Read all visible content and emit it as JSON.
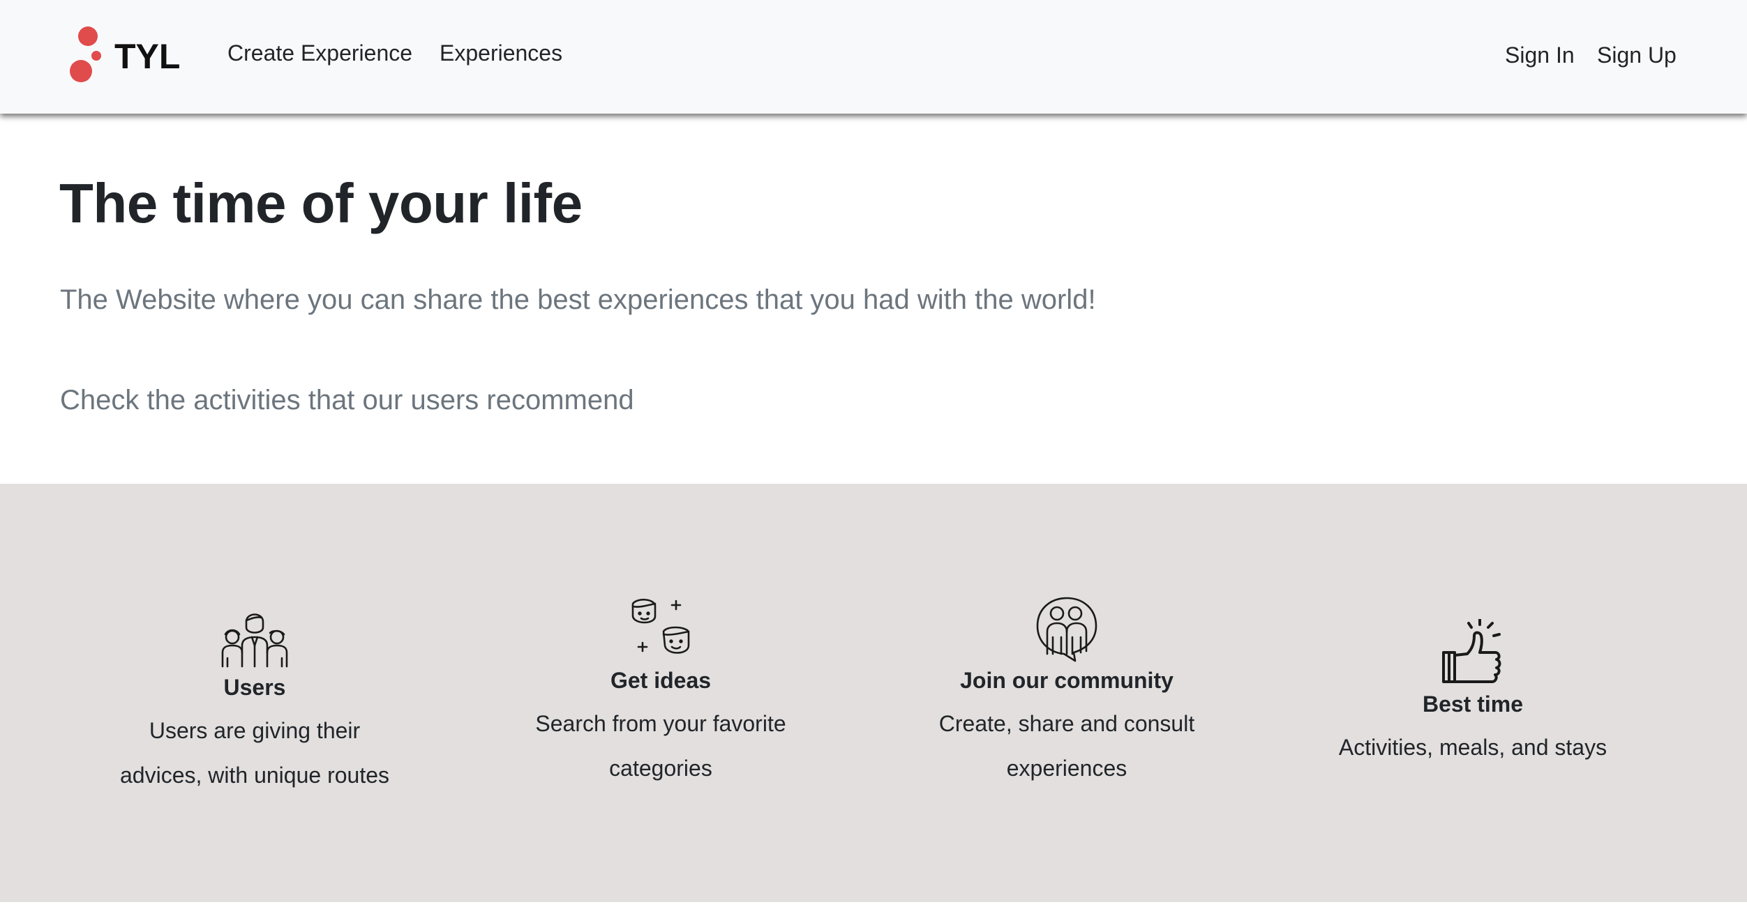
{
  "navbar": {
    "brand": "TYL",
    "brand_color": "#e04b4b",
    "links": [
      {
        "label": "Create Experience"
      },
      {
        "label": "Experiences"
      }
    ],
    "auth": {
      "sign_in": "Sign In",
      "sign_up": "Sign Up"
    }
  },
  "hero": {
    "title": "The time of your life",
    "subtitle": "The Website where you can share the best experiences that you had with the world!",
    "cta_text": "Check the activities that our users recommend"
  },
  "features": [
    {
      "icon": "users-group-icon",
      "title": "Users",
      "description_line1": "Users are giving their",
      "description_line2": "advices, with unique routes"
    },
    {
      "icon": "ideas-faces-icon",
      "title": "Get ideas",
      "description_line1": "Search from your favorite",
      "description_line2": "categories"
    },
    {
      "icon": "community-icon",
      "title": "Join our community",
      "description_line1": "Create, share and consult",
      "description_line2": "experiences"
    },
    {
      "icon": "thumbs-up-icon",
      "title": "Best time",
      "description_line1": "Activities, meals, and stays",
      "description_line2": ""
    }
  ],
  "colors": {
    "navbar_bg": "#f8f9fa",
    "features_bg": "#e2dfde",
    "muted_text": "#6c757d",
    "text": "#212529"
  }
}
